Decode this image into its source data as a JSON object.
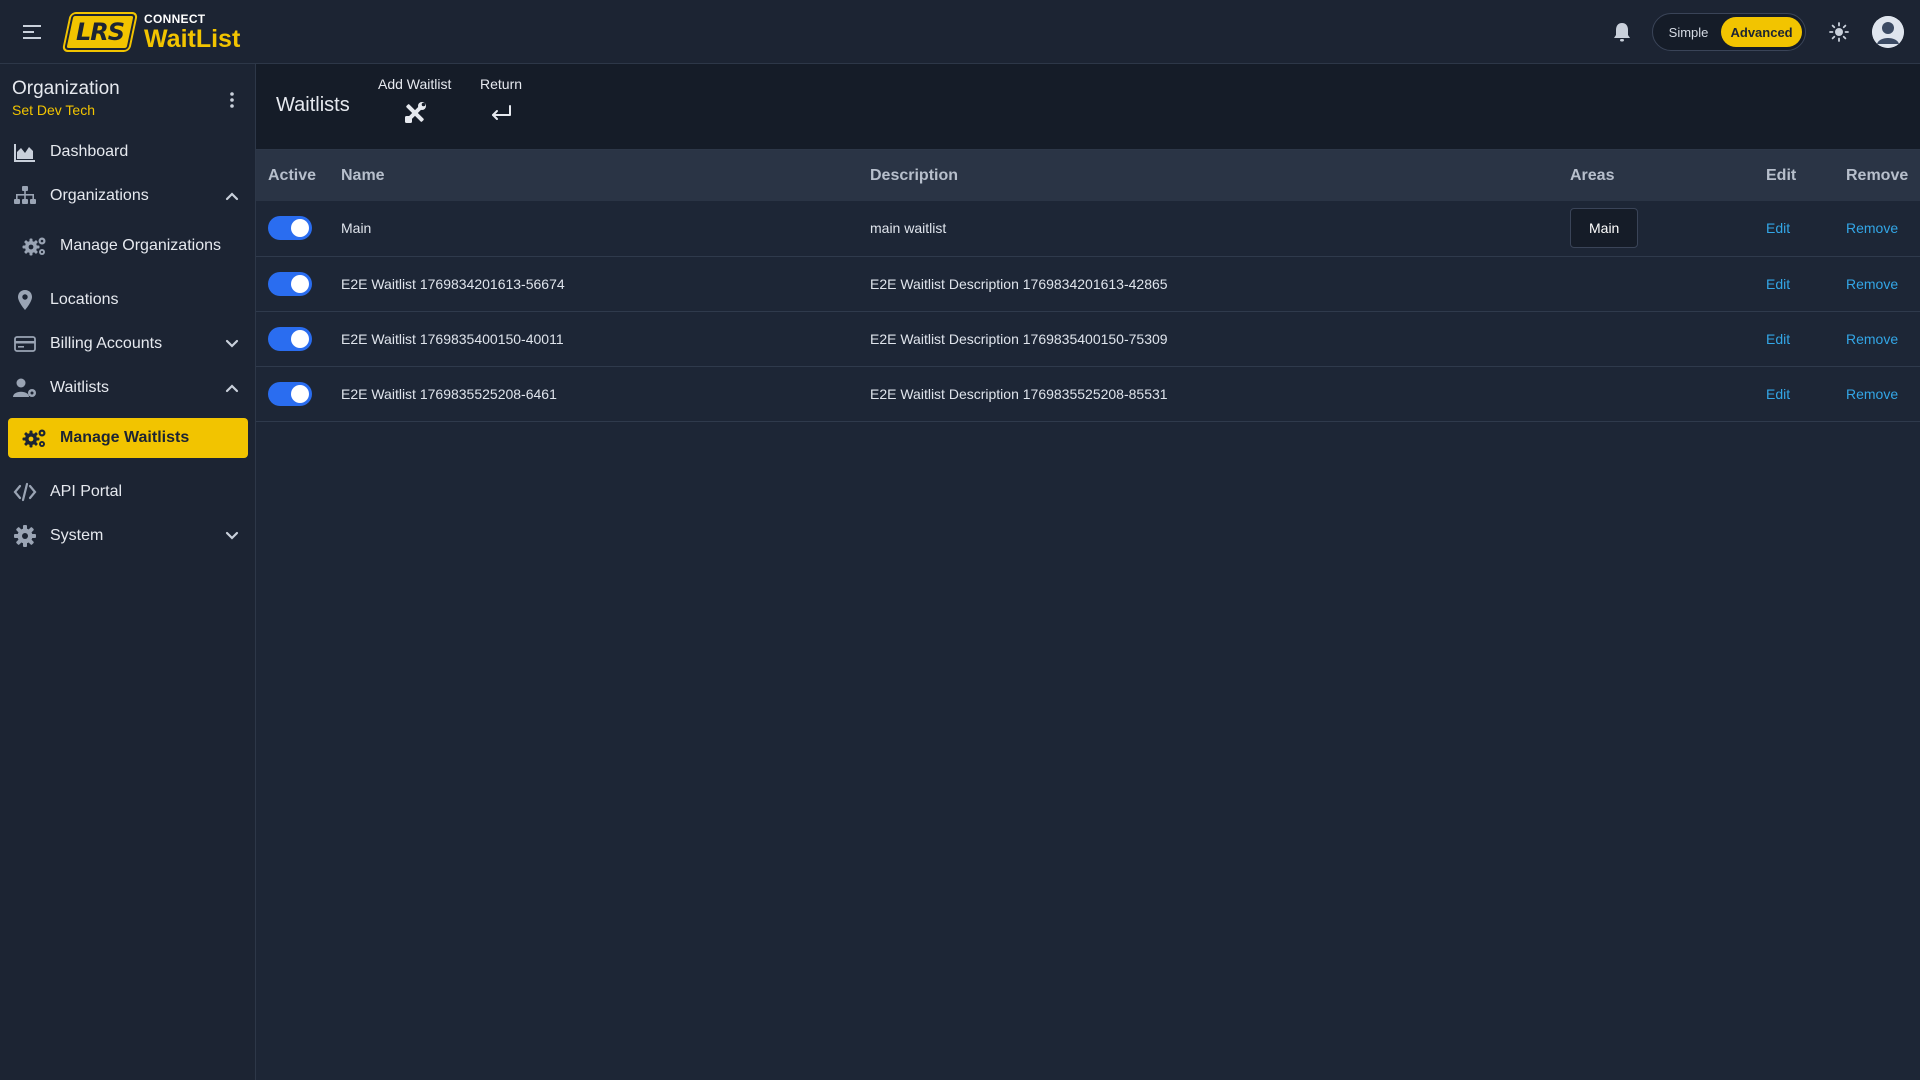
{
  "app": {
    "logo_badge": "LRS",
    "logo_connect": "CONNECT",
    "logo_name": "WaitList"
  },
  "topbar": {
    "mode_simple": "Simple",
    "mode_advanced": "Advanced",
    "mode_selected": "Advanced",
    "icons": [
      "menu-icon",
      "bell-icon",
      "sun-icon",
      "user-avatar-icon"
    ]
  },
  "sidebar": {
    "org_title": "Organization",
    "org_name": "Set Dev Tech",
    "items": [
      {
        "label": "Dashboard",
        "icon": "chart-icon"
      },
      {
        "label": "Organizations",
        "icon": "hierarchy-icon",
        "expanded": true
      },
      {
        "label": "Manage Organizations",
        "icon": "gears-icon"
      },
      {
        "label": "Locations",
        "icon": "map-pin-icon"
      },
      {
        "label": "Billing Accounts",
        "icon": "credit-card-icon",
        "expanded": false
      },
      {
        "label": "Waitlists",
        "icon": "user-gear-icon",
        "expanded": true
      },
      {
        "label": "Manage Waitlists",
        "icon": "gears-icon",
        "active": true
      },
      {
        "label": "API Portal",
        "icon": "code-icon"
      },
      {
        "label": "System",
        "icon": "gear-icon",
        "expanded": false
      }
    ]
  },
  "page": {
    "title": "Waitlists",
    "add_label": "Add Waitlist",
    "return_label": "Return"
  },
  "table": {
    "headers": [
      "Active",
      "Name",
      "Description",
      "Areas",
      "Edit",
      "Remove"
    ],
    "rows": [
      {
        "active": true,
        "name": "Main",
        "description": "main waitlist",
        "area": "Main",
        "edit": "Edit",
        "remove": "Remove"
      },
      {
        "active": true,
        "name": "E2E Waitlist 1769834201613-56674",
        "description": "E2E Waitlist Description 1769834201613-42865",
        "area": "",
        "edit": "Edit",
        "remove": "Remove"
      },
      {
        "active": true,
        "name": "E2E Waitlist 1769835400150-40011",
        "description": "E2E Waitlist Description 1769835400150-75309",
        "area": "",
        "edit": "Edit",
        "remove": "Remove"
      },
      {
        "active": true,
        "name": "E2E Waitlist 1769835525208-6461",
        "description": "E2E Waitlist Description 1769835525208-85531",
        "area": "",
        "edit": "Edit",
        "remove": "Remove"
      }
    ]
  },
  "colors": {
    "accent": "#f2c400",
    "background": "#1d2636",
    "toggle_on": "#2a6df0",
    "link": "#33a6e6"
  }
}
